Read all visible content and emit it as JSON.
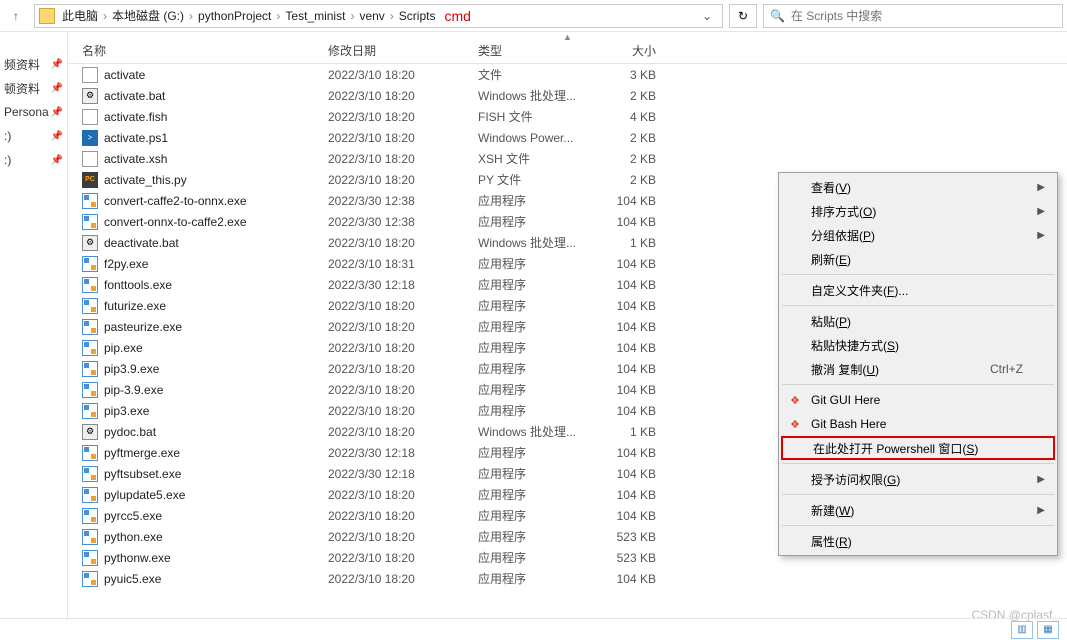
{
  "breadcrumb": [
    "此电脑",
    "本地磁盘 (G:)",
    "pythonProject",
    "Test_minist",
    "venv",
    "Scripts"
  ],
  "annotation": "cmd",
  "search": {
    "placeholder": "在 Scripts 中搜索"
  },
  "columns": {
    "name": "名称",
    "date": "修改日期",
    "type": "类型",
    "size": "大小"
  },
  "left_items": [
    "频资料",
    "顿资料",
    "Persona",
    ":)",
    ":)"
  ],
  "files": [
    {
      "icon": "file",
      "name": "activate",
      "date": "2022/3/10 18:20",
      "type": "文件",
      "size": "3 KB"
    },
    {
      "icon": "bat",
      "name": "activate.bat",
      "date": "2022/3/10 18:20",
      "type": "Windows 批处理...",
      "size": "2 KB"
    },
    {
      "icon": "file",
      "name": "activate.fish",
      "date": "2022/3/10 18:20",
      "type": "FISH 文件",
      "size": "4 KB"
    },
    {
      "icon": "ps1",
      "name": "activate.ps1",
      "date": "2022/3/10 18:20",
      "type": "Windows Power...",
      "size": "2 KB"
    },
    {
      "icon": "file",
      "name": "activate.xsh",
      "date": "2022/3/10 18:20",
      "type": "XSH 文件",
      "size": "2 KB"
    },
    {
      "icon": "py",
      "name": "activate_this.py",
      "date": "2022/3/10 18:20",
      "type": "PY 文件",
      "size": "2 KB"
    },
    {
      "icon": "exe",
      "name": "convert-caffe2-to-onnx.exe",
      "date": "2022/3/30 12:38",
      "type": "应用程序",
      "size": "104 KB"
    },
    {
      "icon": "exe",
      "name": "convert-onnx-to-caffe2.exe",
      "date": "2022/3/30 12:38",
      "type": "应用程序",
      "size": "104 KB"
    },
    {
      "icon": "bat",
      "name": "deactivate.bat",
      "date": "2022/3/10 18:20",
      "type": "Windows 批处理...",
      "size": "1 KB"
    },
    {
      "icon": "exe",
      "name": "f2py.exe",
      "date": "2022/3/10 18:31",
      "type": "应用程序",
      "size": "104 KB"
    },
    {
      "icon": "exe",
      "name": "fonttools.exe",
      "date": "2022/3/30 12:18",
      "type": "应用程序",
      "size": "104 KB"
    },
    {
      "icon": "exe",
      "name": "futurize.exe",
      "date": "2022/3/10 18:20",
      "type": "应用程序",
      "size": "104 KB"
    },
    {
      "icon": "exe",
      "name": "pasteurize.exe",
      "date": "2022/3/10 18:20",
      "type": "应用程序",
      "size": "104 KB"
    },
    {
      "icon": "exe",
      "name": "pip.exe",
      "date": "2022/3/10 18:20",
      "type": "应用程序",
      "size": "104 KB"
    },
    {
      "icon": "exe",
      "name": "pip3.9.exe",
      "date": "2022/3/10 18:20",
      "type": "应用程序",
      "size": "104 KB"
    },
    {
      "icon": "exe",
      "name": "pip-3.9.exe",
      "date": "2022/3/10 18:20",
      "type": "应用程序",
      "size": "104 KB"
    },
    {
      "icon": "exe",
      "name": "pip3.exe",
      "date": "2022/3/10 18:20",
      "type": "应用程序",
      "size": "104 KB"
    },
    {
      "icon": "bat",
      "name": "pydoc.bat",
      "date": "2022/3/10 18:20",
      "type": "Windows 批处理...",
      "size": "1 KB"
    },
    {
      "icon": "exe",
      "name": "pyftmerge.exe",
      "date": "2022/3/30 12:18",
      "type": "应用程序",
      "size": "104 KB"
    },
    {
      "icon": "exe",
      "name": "pyftsubset.exe",
      "date": "2022/3/30 12:18",
      "type": "应用程序",
      "size": "104 KB"
    },
    {
      "icon": "exe",
      "name": "pylupdate5.exe",
      "date": "2022/3/10 18:20",
      "type": "应用程序",
      "size": "104 KB"
    },
    {
      "icon": "exe",
      "name": "pyrcc5.exe",
      "date": "2022/3/10 18:20",
      "type": "应用程序",
      "size": "104 KB"
    },
    {
      "icon": "exe",
      "name": "python.exe",
      "date": "2022/3/10 18:20",
      "type": "应用程序",
      "size": "523 KB"
    },
    {
      "icon": "exe",
      "name": "pythonw.exe",
      "date": "2022/3/10 18:20",
      "type": "应用程序",
      "size": "523 KB"
    },
    {
      "icon": "exe",
      "name": "pyuic5.exe",
      "date": "2022/3/10 18:20",
      "type": "应用程序",
      "size": "104 KB"
    }
  ],
  "context_menu": {
    "view": {
      "label": "查看",
      "key": "V"
    },
    "sort": {
      "label": "排序方式",
      "key": "O"
    },
    "group": {
      "label": "分组依据",
      "key": "P"
    },
    "refresh": {
      "label": "刷新",
      "key": "E"
    },
    "custom": {
      "label": "自定义文件夹",
      "key": "F",
      "suffix": "..."
    },
    "paste": {
      "label": "粘贴",
      "key": "P"
    },
    "paste_shortcut": {
      "label": "粘贴快捷方式",
      "key": "S"
    },
    "undo": {
      "label": "撤消 复制",
      "key": "U",
      "shortcut": "Ctrl+Z"
    },
    "git_gui": {
      "label": "Git GUI Here"
    },
    "git_bash": {
      "label": "Git Bash Here"
    },
    "powershell": {
      "label": "在此处打开 Powershell 窗口",
      "key": "S"
    },
    "grant": {
      "label": "授予访问权限",
      "key": "G"
    },
    "new": {
      "label": "新建",
      "key": "W"
    },
    "properties": {
      "label": "属性",
      "key": "R"
    }
  },
  "watermark": "CSDN @cplasf_"
}
